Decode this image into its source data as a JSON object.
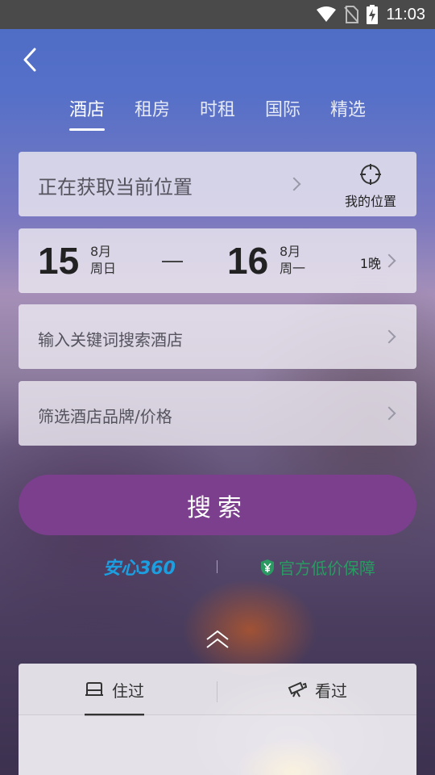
{
  "status_bar": {
    "time": "11:03",
    "icons": [
      "wifi-icon",
      "no-sim-icon",
      "battery-charging-icon"
    ]
  },
  "tabs": [
    {
      "label": "酒店",
      "active": true
    },
    {
      "label": "租房",
      "active": false
    },
    {
      "label": "时租",
      "active": false
    },
    {
      "label": "国际",
      "active": false
    },
    {
      "label": "精选",
      "active": false
    }
  ],
  "location": {
    "text": "正在获取当前位置",
    "my_location_label": "我的位置"
  },
  "dates": {
    "checkin": {
      "day": "15",
      "month": "8月",
      "weekday": "周日"
    },
    "checkout": {
      "day": "16",
      "month": "8月",
      "weekday": "周一"
    },
    "nights": "1晚"
  },
  "keyword_field": {
    "placeholder": "输入关键词搜索酒店"
  },
  "filter_field": {
    "placeholder": "筛选酒店品牌/价格"
  },
  "search_button": {
    "label": "搜索"
  },
  "badges": {
    "anxin": "安心360",
    "price_guarantee": "官方低价保障",
    "price_icon": "yen-shield-icon"
  },
  "history": {
    "tabs": [
      {
        "label": "住过",
        "icon": "bed-icon",
        "active": true
      },
      {
        "label": "看过",
        "icon": "telescope-icon",
        "active": false
      }
    ]
  },
  "colors": {
    "accent": "#7b3f8d",
    "price_green": "#2a9a62",
    "anxin_blue": "#1c9fe0"
  }
}
